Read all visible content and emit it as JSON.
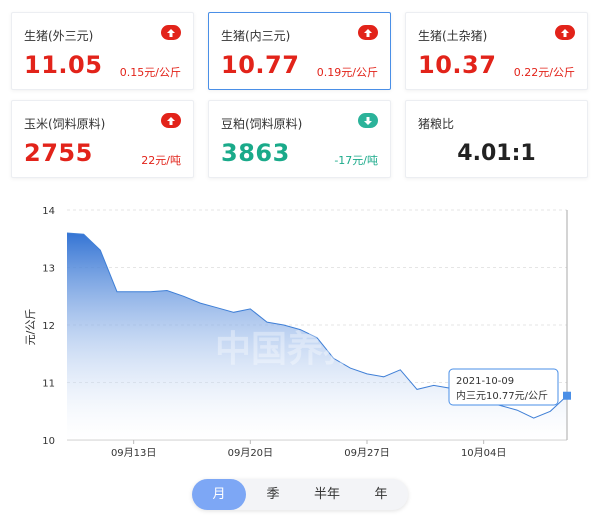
{
  "cards": [
    {
      "title": "生猪(外三元)",
      "value": "11.05",
      "change": "0.15元/公斤",
      "trend": "up"
    },
    {
      "title": "生猪(内三元)",
      "value": "10.77",
      "change": "0.19元/公斤",
      "trend": "up",
      "selected": true
    },
    {
      "title": "生猪(土杂猪)",
      "value": "10.37",
      "change": "0.22元/公斤",
      "trend": "up"
    },
    {
      "title": "玉米(饲料原料)",
      "value": "2755",
      "change": "22元/吨",
      "trend": "up"
    },
    {
      "title": "豆粕(饲料原料)",
      "value": "3863",
      "change": "-17元/吨",
      "trend": "down"
    }
  ],
  "ratio_card": {
    "title": "猪粮比",
    "value": "4.01:1"
  },
  "colors": {
    "up": "#e2231a",
    "down": "#1aaa8a",
    "accent": "#4a8fe7",
    "area": "#3f7fd6",
    "up_badge": "#e2231a",
    "down_badge": "#2bb39a"
  },
  "icons": {
    "up": "arrow-up-icon",
    "down": "arrow-down-icon"
  },
  "watermark": "中国养猪网",
  "chart_data": {
    "type": "area",
    "ylabel": "元/公斤",
    "ylim": [
      10,
      14
    ],
    "yticks": [
      "10",
      "11",
      "12",
      "13",
      "14"
    ],
    "xticks": [
      "09月13日",
      "09月20日",
      "09月27日",
      "10月04日"
    ],
    "xtick_dates": [
      "2021-09-13",
      "2021-09-20",
      "2021-09-27",
      "2021-10-04"
    ],
    "x": [
      "2021-09-09",
      "2021-09-10",
      "2021-09-11",
      "2021-09-12",
      "2021-09-13",
      "2021-09-14",
      "2021-09-15",
      "2021-09-16",
      "2021-09-17",
      "2021-09-18",
      "2021-09-19",
      "2021-09-20",
      "2021-09-21",
      "2021-09-22",
      "2021-09-23",
      "2021-09-24",
      "2021-09-25",
      "2021-09-26",
      "2021-09-27",
      "2021-09-28",
      "2021-09-29",
      "2021-09-30",
      "2021-10-01",
      "2021-10-02",
      "2021-10-03",
      "2021-10-04",
      "2021-10-05",
      "2021-10-06",
      "2021-10-07",
      "2021-10-08",
      "2021-10-09"
    ],
    "y": [
      13.6,
      13.58,
      13.3,
      12.58,
      12.58,
      12.58,
      12.6,
      12.5,
      12.38,
      12.3,
      12.22,
      12.28,
      12.05,
      12.0,
      11.92,
      11.78,
      11.42,
      11.25,
      11.15,
      11.1,
      11.22,
      10.88,
      10.95,
      10.9,
      10.75,
      10.68,
      10.6,
      10.52,
      10.38,
      10.5,
      10.77
    ],
    "tooltip": {
      "date": "2021-10-09",
      "text": "内三元10.77元/公斤"
    },
    "grid": true
  },
  "period_tabs": [
    "月",
    "季",
    "半年",
    "年"
  ],
  "active_period": "月"
}
